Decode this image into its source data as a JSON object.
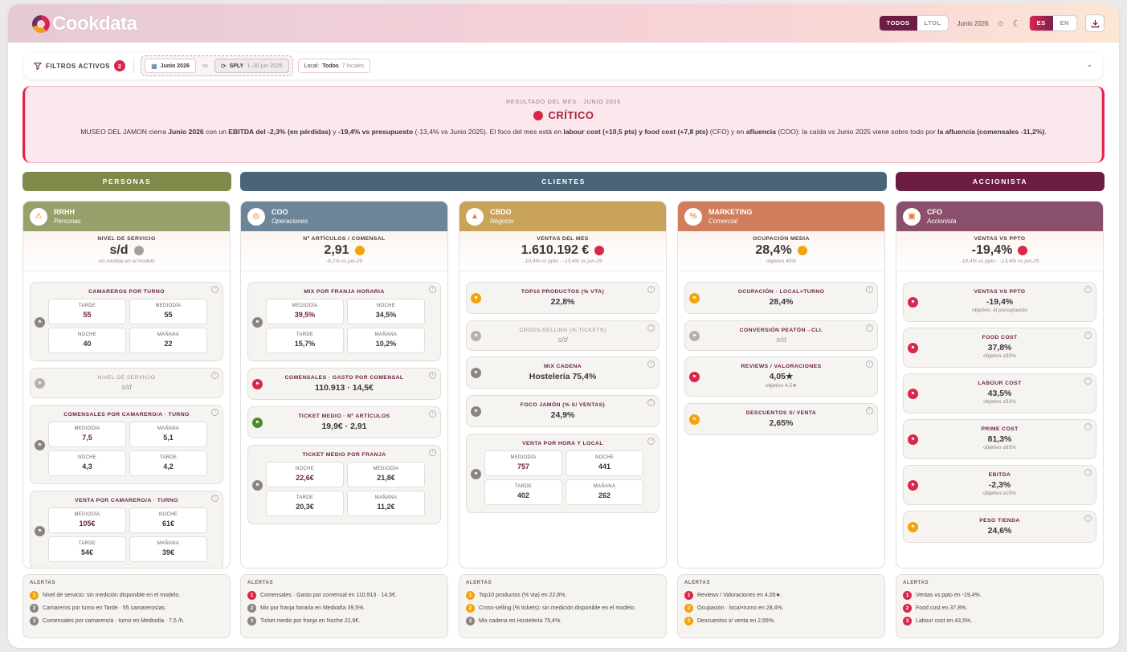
{
  "header": {
    "logo": "Cookdata",
    "scope_options": [
      "TODOS",
      "LTOL"
    ],
    "period": "Junio 2026",
    "lang_options": [
      "ES",
      "EN"
    ],
    "colors": {
      "brand": "#6b1e42",
      "accent": "#d9264b"
    }
  },
  "filters": {
    "title": "FILTROS ACTIVOS",
    "count": "2",
    "period_chip": "Junio 2026",
    "vs": "vs",
    "compare_label": "SPLY",
    "compare_range": "1–30 jun 2025",
    "local_label": "Local:",
    "local_value": "Todos",
    "local_count": "7 locales"
  },
  "result": {
    "kicker": "RESULTADO DEL MES · JUNIO 2026",
    "status": "CRÍTICO",
    "t1": "MUSEO DEL JAMON cierra ",
    "b1": "Junio 2026",
    "t2": " con un ",
    "b2": "EBITDA del -2,3% (en pérdidas)",
    "t3": " y ",
    "b3": "-19,4% vs presupuesto",
    "t4": " (-13,4% vs Junio 2025). El foco del mes está en ",
    "b4": "labour cost (+10,5 pts) y food cost (+7,8 pts)",
    "t5": " (CFO) y en ",
    "b5": "afluencia",
    "t6": " (COO): la caída vs Junio 2025 viene sobre todo por ",
    "b6": "la afluencia (comensales -11,2%)",
    "t7": "."
  },
  "bands": {
    "personas": "PERSONAS",
    "clientes": "CLIENTES",
    "accionista": "ACCIONISTA"
  },
  "rrhh": {
    "name": "RRHH",
    "sub": "Personas",
    "kpi": {
      "label": "NIVEL DE SERVICIO",
      "value": "s/d",
      "sub": "sin medida en el modelo"
    },
    "c1": {
      "title": "CAMAREROS POR TURNO",
      "cells": [
        [
          "TARDE",
          "55"
        ],
        [
          "MEDIODÍA",
          "55"
        ],
        [
          "NOCHE",
          "40"
        ],
        [
          "MAÑANA",
          "22"
        ]
      ]
    },
    "c2": {
      "title": "NIVEL DE SERVICIO",
      "value": "s/d"
    },
    "c3": {
      "title": "COMENSALES POR CAMARERO/A · TURNO",
      "cells": [
        [
          "MEDIODÍA",
          "7,5"
        ],
        [
          "MAÑANA",
          "5,1"
        ],
        [
          "NOCHE",
          "4,3"
        ],
        [
          "TARDE",
          "4,2"
        ]
      ]
    },
    "c4": {
      "title": "VENTA POR CAMARERO/A · TURNO",
      "cells": [
        [
          "MEDIODÍA",
          "105€"
        ],
        [
          "NOCHE",
          "61€"
        ],
        [
          "TARDE",
          "54€"
        ],
        [
          "MAÑANA",
          "39€"
        ]
      ]
    }
  },
  "coo": {
    "name": "COO",
    "sub": "Operaciones",
    "kpi": {
      "label": "Nº ARTÍCULOS / COMENSAL",
      "value": "2,91",
      "sub": "-6,1% vs jun-25"
    },
    "c1": {
      "title": "MIX POR FRANJA HORARIA",
      "cells": [
        [
          "MEDIODÍA",
          "39,5%"
        ],
        [
          "NOCHE",
          "34,5%"
        ],
        [
          "TARDE",
          "15,7%"
        ],
        [
          "MAÑANA",
          "10,2%"
        ]
      ]
    },
    "c2": {
      "title": "COMENSALES · GASTO POR COMENSAL",
      "value": "110.913 · 14,5€"
    },
    "c3": {
      "title": "TICKET MEDIO · Nº ARTÍCULOS",
      "value": "19,9€ · 2,91"
    },
    "c4": {
      "title": "TICKET MEDIO POR FRANJA",
      "cells": [
        [
          "NOCHE",
          "22,6€"
        ],
        [
          "MEDIODÍA",
          "21,8€"
        ],
        [
          "TARDE",
          "20,3€"
        ],
        [
          "MAÑANA",
          "11,2€"
        ]
      ]
    }
  },
  "cbdo": {
    "name": "CBDO",
    "sub": "Negocio",
    "kpi": {
      "label": "VENTAS DEL MES",
      "value": "1.610.192 €",
      "sub": "-19,4% vs ppto · -13,4% vs jun-25"
    },
    "c1": {
      "title": "TOP10 PRODUCTOS (% VTA)",
      "value": "22,8%"
    },
    "c2": {
      "title": "CROSS-SELLING (% TICKETS)",
      "value": "s/d"
    },
    "c3": {
      "title": "MIX CADENA",
      "value": "Hostelería 75,4%"
    },
    "c4": {
      "title": "FOCO JAMÓN (% S/ VENTAS)",
      "value": "24,9%"
    },
    "c5": {
      "title": "VENTA POR HORA Y LOCAL",
      "cells": [
        [
          "MEDIODÍA",
          "757"
        ],
        [
          "NOCHE",
          "441"
        ],
        [
          "TARDE",
          "402"
        ],
        [
          "MAÑANA",
          "262"
        ]
      ]
    }
  },
  "marketing": {
    "name": "MARKETING",
    "sub": "Comercial",
    "kpi": {
      "label": "OCUPACIÓN MEDIA",
      "value": "28,4%",
      "sub": "objetivo 40%"
    },
    "c1": {
      "title": "OCUPACIÓN · LOCAL×TURNO",
      "value": "28,4%"
    },
    "c2": {
      "title": "CONVERSIÓN PEATÓN→CLI.",
      "value": "s/d"
    },
    "c3": {
      "title": "REVIEWS / VALORACIONES",
      "value": "4,05★",
      "sub": "objetivo 4,5★"
    },
    "c4": {
      "title": "DESCUENTOS S/ VENTA",
      "value": "2,65%"
    }
  },
  "cfo": {
    "name": "CFO",
    "sub": "Accionista",
    "kpi": {
      "label": "VENTAS VS PPTO",
      "value": "-19,4%",
      "sub": "-19,4% vs ppto · -13,4% vs jun-25"
    },
    "c1": {
      "title": "VENTAS VS PPTO",
      "value": "-19,4%",
      "sub": "objetivo: el presupuesto"
    },
    "c2": {
      "title": "FOOD COST",
      "value": "37,8%",
      "sub": "objetivo ≤30%"
    },
    "c3": {
      "title": "LABOUR COST",
      "value": "43,5%",
      "sub": "objetivo ≤33%"
    },
    "c4": {
      "title": "PRIME COST",
      "value": "81,3%",
      "sub": "objetivo ≤65%"
    },
    "c5": {
      "title": "EBITDA",
      "value": "-2,3%",
      "sub": "objetivo ≥10%"
    },
    "c6": {
      "title": "PESO TIENDA",
      "value": "24,6%"
    }
  },
  "alerts": {
    "title": "ALERTAS",
    "rrhh": [
      "Nivel de servicio: sin medición disponible en el modelo.",
      "Camareros por turno en Tarde · 55 camareros/as.",
      "Comensales por camarero/a · turno en Mediodía · 7,5 /h."
    ],
    "coo": [
      "Comensales · Gasto por comensal en 110.913 · 14,5€.",
      "Mix por franja horaria en Mediodía 39,5%.",
      "Ticket medio por franja en Noche 22,6€."
    ],
    "cbdo": [
      "Top10 productos (% vta) en 22,8%.",
      "Cross-selling (% tickets): sin medición disponible en el modelo.",
      "Mix cadena en Hostelería 75,4%."
    ],
    "marketing": [
      "Reviews / Valoraciones en 4,05★.",
      "Ocupación · local×turno en 28,4%.",
      "Descuentos s/ venta en 2,65%."
    ],
    "cfo": [
      "Ventas vs ppto en -19,4%.",
      "Food cost en 37,8%.",
      "Labour cost en 43,5%."
    ]
  }
}
